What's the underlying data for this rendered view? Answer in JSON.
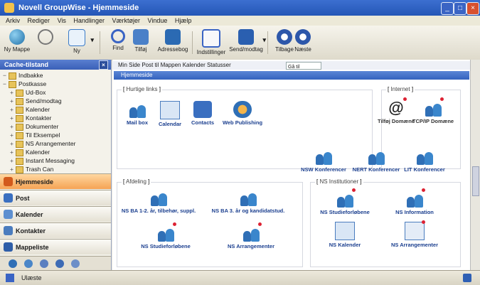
{
  "window": {
    "title": "Novell GroupWise - Hjemmeside"
  },
  "menu": [
    "Arkiv",
    "Rediger",
    "Vis",
    "Handlinger",
    "Værktøjer",
    "Vindue",
    "Hjælp"
  ],
  "toolbar": {
    "items": [
      {
        "label": "Ny Mappe",
        "icon": "globe-icon"
      },
      {
        "label": "",
        "icon": "refresh-icon"
      },
      {
        "label": "Ny",
        "icon": "new-item-icon"
      },
      {
        "label": "Find",
        "icon": "search-icon"
      },
      {
        "label": "Tilføj",
        "icon": "add-icon"
      },
      {
        "label": "Adressebog",
        "icon": "addressbook-icon"
      },
      {
        "label": "Indstillinger",
        "icon": "settings-icon"
      },
      {
        "label": "Send/modtag",
        "icon": "send-receive-icon"
      },
      {
        "label": "Tilbage",
        "icon": "back-icon"
      },
      {
        "label": "Næste",
        "icon": "forward-icon"
      }
    ]
  },
  "sidebar": {
    "header": "Cache-tilstand",
    "tree": [
      {
        "label": "Indbakke",
        "level": 0
      },
      {
        "label": "Postkasse",
        "level": 0
      },
      {
        "label": "Ud-Box",
        "level": 1
      },
      {
        "label": "Send/modtag",
        "level": 1
      },
      {
        "label": "Kalender",
        "level": 1
      },
      {
        "label": "Kontakter",
        "level": 1
      },
      {
        "label": "Dokumenter",
        "level": 1
      },
      {
        "label": "Til Eksempel",
        "level": 1
      },
      {
        "label": "NS Arrangementer",
        "level": 1
      },
      {
        "label": "Kalender",
        "level": 1
      },
      {
        "label": "Instant Messaging",
        "level": 1
      },
      {
        "label": "Trash Can",
        "level": 1
      }
    ],
    "nav": [
      {
        "label": "Hjemmeside",
        "active": true
      },
      {
        "label": "Post",
        "active": false
      },
      {
        "label": "Kalender",
        "active": false
      },
      {
        "label": "Kontakter",
        "active": false
      },
      {
        "label": "Mappeliste",
        "active": false
      }
    ]
  },
  "main": {
    "address": "Min Side    Post til Mappen    Kalender Statusser",
    "address_box": "Gå til",
    "bluebar": "Hjemmeside",
    "groups": {
      "top_left": "Hurtige links",
      "top_right": "Internet",
      "bottom_left": "Afdeling",
      "bottom_right": "NS Institutioner"
    },
    "icons_top": [
      "Mail box",
      "Calendar",
      "Contacts",
      "Web Publishing"
    ],
    "icons_right": [
      "Tilføj Domæne",
      "TCP/IP Domæne"
    ],
    "icons_conf": [
      "NSW Konferencer",
      "NERT Konferencer",
      "LIT Konferencer"
    ],
    "icons_bl": [
      "NS BA 1-2. år, tilbehør, suppl.",
      "NS BA 3. år og kandidatstud.",
      "NS Studieforløbene",
      "NS Arrangementer"
    ],
    "icons_br": [
      "NS Studieforløbene",
      "NS Information",
      "NS Kalender",
      "NS Arrangementer"
    ]
  },
  "status": {
    "text": "Ulæste"
  },
  "colors": {
    "titlebar": "#2456b6",
    "accent_nav": "#f5a354",
    "icon_blue": "#2f6fb6"
  }
}
